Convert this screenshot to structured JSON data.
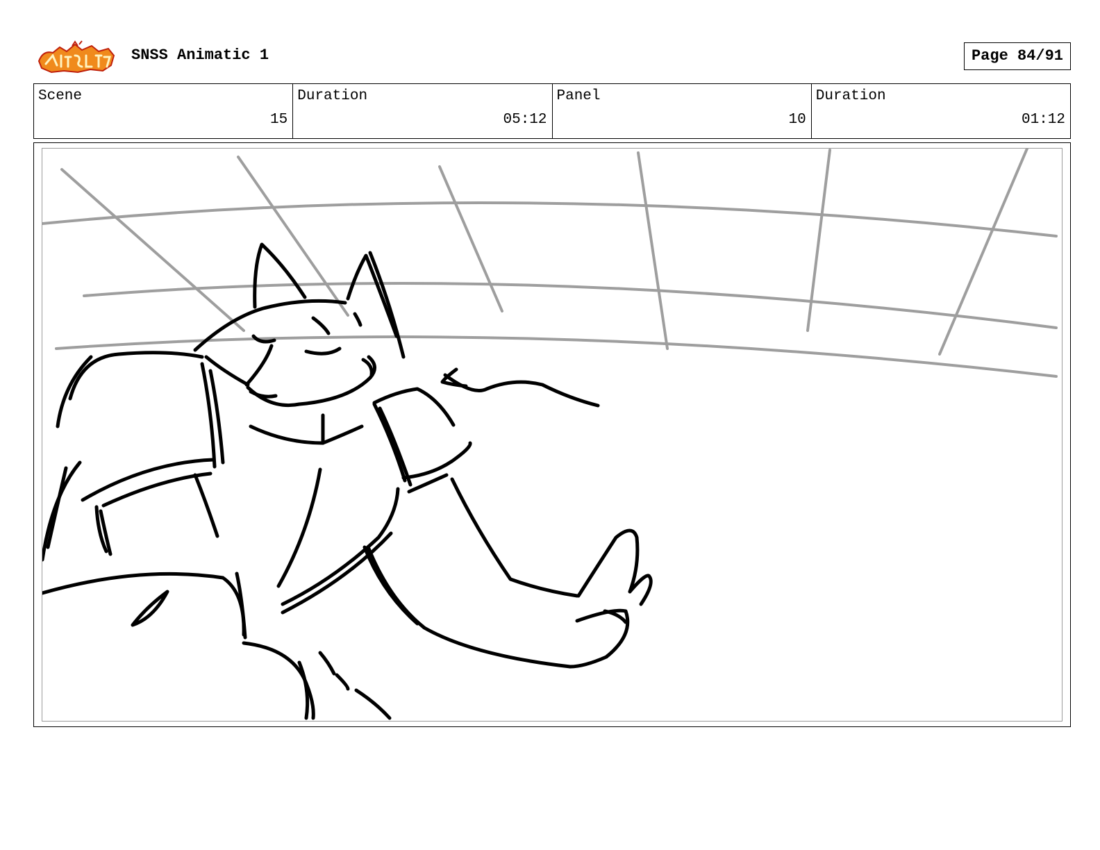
{
  "header": {
    "project_title": "SNSS Animatic 1",
    "page_label": "Page 84/91"
  },
  "info": {
    "scene_label": "Scene",
    "scene_value": "15",
    "scene_duration_label": "Duration",
    "scene_duration_value": "05:12",
    "panel_label": "Panel",
    "panel_value": "10",
    "panel_duration_label": "Duration",
    "panel_duration_value": "01:12"
  },
  "panel": {
    "sketch_color": "#000000",
    "background_line_color": "#9e9e9e"
  }
}
